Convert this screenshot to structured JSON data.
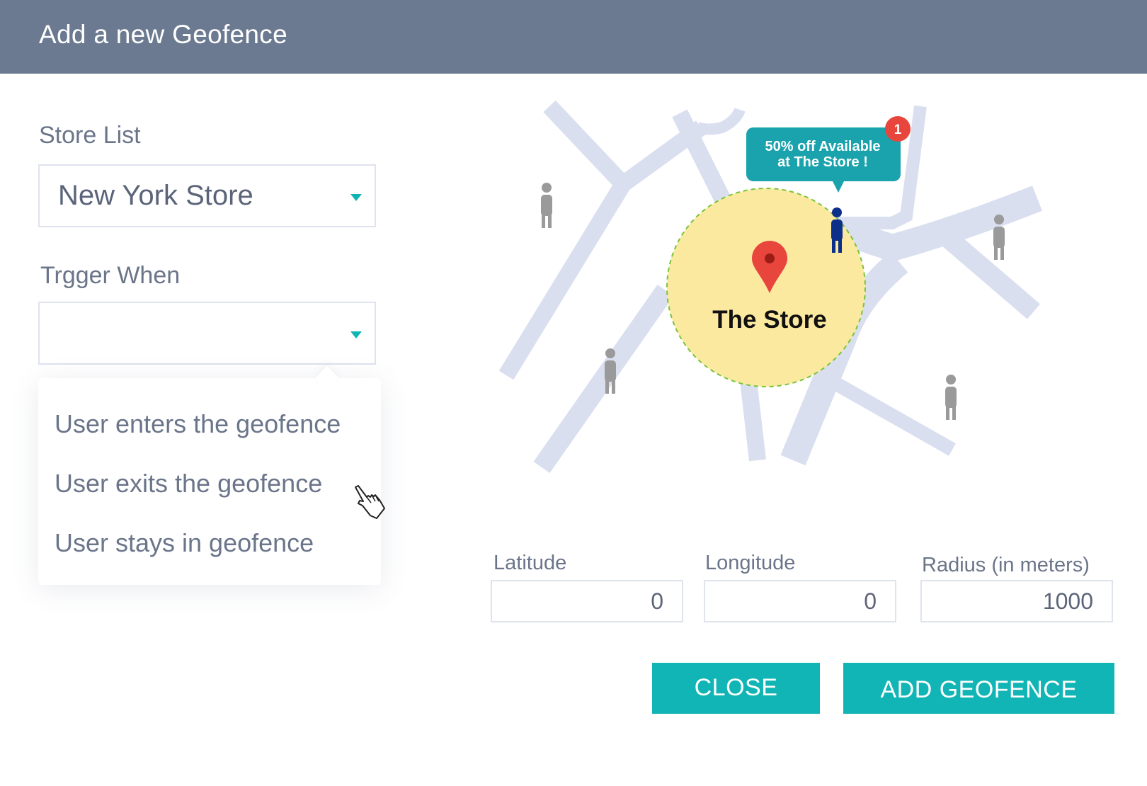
{
  "header": {
    "title": "Add a new Geofence"
  },
  "store_list": {
    "label": "Store List",
    "value": "New York Store"
  },
  "trigger": {
    "label": "Trgger When",
    "value": "",
    "options": [
      "User enters the geofence",
      "User exits the geofence",
      "User stays in geofence"
    ]
  },
  "map": {
    "store_label": "The Store",
    "promo_line1": "50% off Available",
    "promo_line2": "at The Store !",
    "notification_count": "1",
    "colors": {
      "road": "#dadff0",
      "geofence_fill": "#fce9a0",
      "geofence_border": "#77c43a",
      "pin": "#e8453c",
      "promo_bubble": "#1aa3ad",
      "badge": "#e8453c",
      "person": "#9a9a9a",
      "active_user": "#0c2f8a"
    }
  },
  "fields": {
    "latitude": {
      "label": "Latitude",
      "value": "0"
    },
    "longitude": {
      "label": "Longitude",
      "value": "0"
    },
    "radius": {
      "label": "Radius (in meters)",
      "value": "1000"
    }
  },
  "buttons": {
    "close": "CLOSE",
    "add": "ADD GEOFENCE"
  },
  "theme": {
    "header_bg": "#6b7a90",
    "accent": "#12b5b5"
  }
}
